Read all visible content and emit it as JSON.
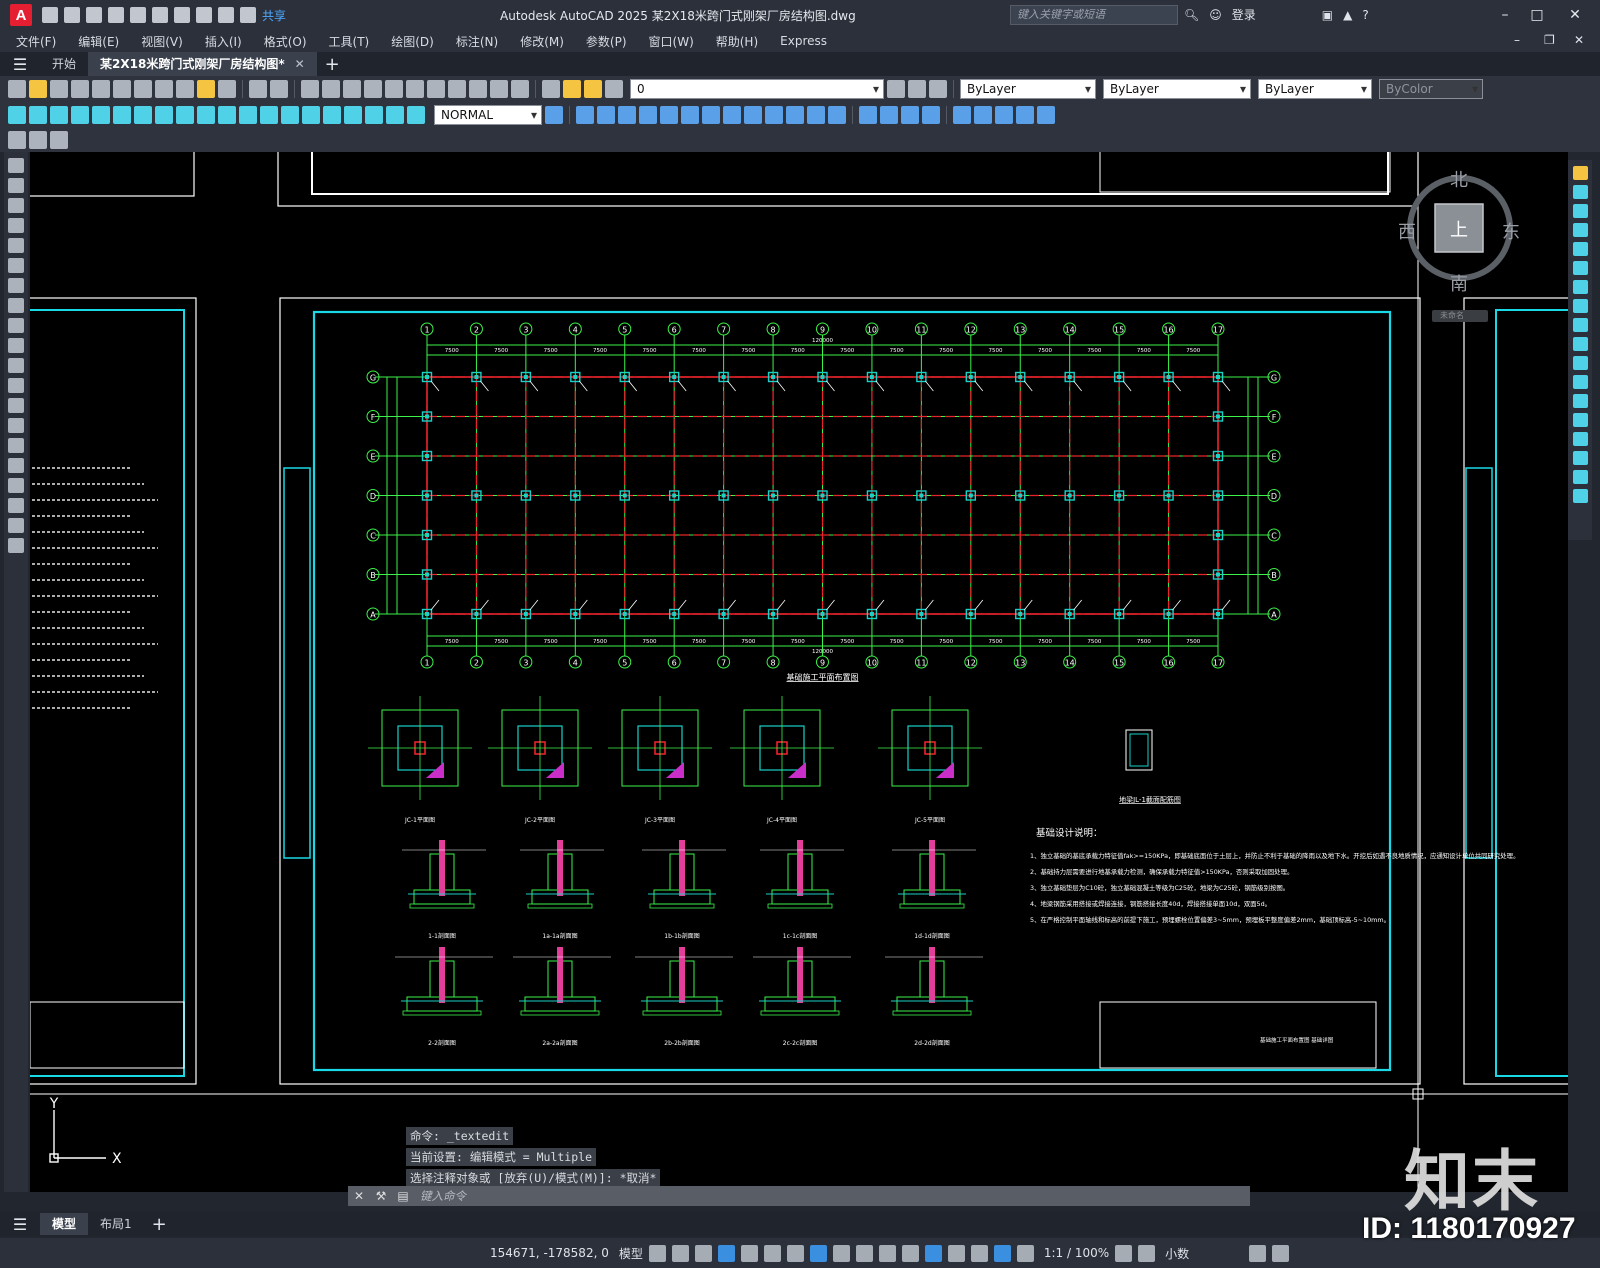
{
  "app": {
    "title": "Autodesk AutoCAD 2025    某2X18米跨门式刚架厂房结构图.dwg",
    "logo": "A",
    "share": "共享",
    "search_placeholder": "键入关键字或短语",
    "login": "登录"
  },
  "menu": [
    "文件(F)",
    "编辑(E)",
    "视图(V)",
    "插入(I)",
    "格式(O)",
    "工具(T)",
    "绘图(D)",
    "标注(N)",
    "修改(M)",
    "参数(P)",
    "窗口(W)",
    "帮助(H)",
    "Express"
  ],
  "tabs": {
    "start": "开始",
    "document": "某2X18米跨门式刚架厂房结构图*"
  },
  "toolbar": {
    "layer_value": "0",
    "text_style": "NORMAL",
    "color": "ByLayer",
    "linetype": "ByLayer",
    "lineweight": "ByLayer",
    "plotstyle": "ByColor"
  },
  "navcube": {
    "north": "北",
    "south": "南",
    "east": "东",
    "west": "西",
    "top": "上",
    "wcs": "未命名"
  },
  "drawing": {
    "plan_title": "基础施工平面布置图",
    "notes_title": "基础设计说明：",
    "notes": [
      "1、独立基础的基底承载力特征值fak>=150KPa，即基础底面位于土层上，并防止不利于基础的降雨以及地下水。开挖后如遇不良地质情况，应通知设计单位共同研究处理。",
      "2、基础持力层需要进行地基承载力检测，确保承载力特征值>150KPa，否则采取加固处理。",
      "3、独立基础垫层为C10砼，独立基础混凝土等级为C25砼，地梁为C25砼，钢筋级别按图。",
      "4、地梁钢筋采用搭接或焊接连接，钢筋搭接长度40d，焊接搭接单面10d，双面5d。",
      "5、在严格控制平面轴线和标高的前提下施工，预埋螺栓位置偏差3~5mm，预埋板平整度偏差2mm，基础顶标高-5~10mm。"
    ],
    "beam_section_title": "地梁JL-1截面配筋图",
    "axis_numbers": [
      "1",
      "2",
      "3",
      "4",
      "5",
      "6",
      "7",
      "8",
      "9",
      "10",
      "11",
      "12",
      "13",
      "14",
      "15",
      "16",
      "17"
    ],
    "axis_letters": [
      "G",
      "F",
      "E",
      "D",
      "C",
      "B",
      "A"
    ],
    "span_dim": "7500",
    "total_dim": "120000",
    "detail_labels_row1": [
      "JC-1平面图",
      "JC-2平面图",
      "JC-3平面图",
      "JC-4平面图",
      "JC-5平面图"
    ],
    "section_labels_row2": [
      "1-1剖面图",
      "1a-1a剖面图",
      "1b-1b剖面图",
      "1c-1c剖面图",
      "1d-1d剖面图"
    ],
    "section_labels_row3": [
      "2-2剖面图",
      "2a-2a剖面图",
      "2b-2b剖面图",
      "2c-2c剖面图",
      "2d-2d剖面图"
    ],
    "titleblock_text": "基础施工平面布置图 基础详图"
  },
  "command": {
    "history": [
      "命令: _textedit",
      "当前设置: 编辑模式 = Multiple",
      "选择注释对象或 [放弃(U)/模式(M)]: *取消*"
    ],
    "input_placeholder": "键入命令"
  },
  "layouts": [
    "模型",
    "布局1"
  ],
  "status": {
    "coords": "154671, -178582, 0",
    "model": "模型",
    "scale": "1:1 / 100%",
    "units": "小数"
  },
  "watermark": {
    "logo_text": "知末",
    "id": "ID: 1180170927"
  },
  "colors": {
    "canvas": "#000000",
    "cyan_frame": "#19d9e6",
    "grid_green": "#3df24a",
    "grid_red": "#e8232b",
    "column_cyan": "#1ad1c7",
    "accent_blue": "#3b8fe0"
  }
}
